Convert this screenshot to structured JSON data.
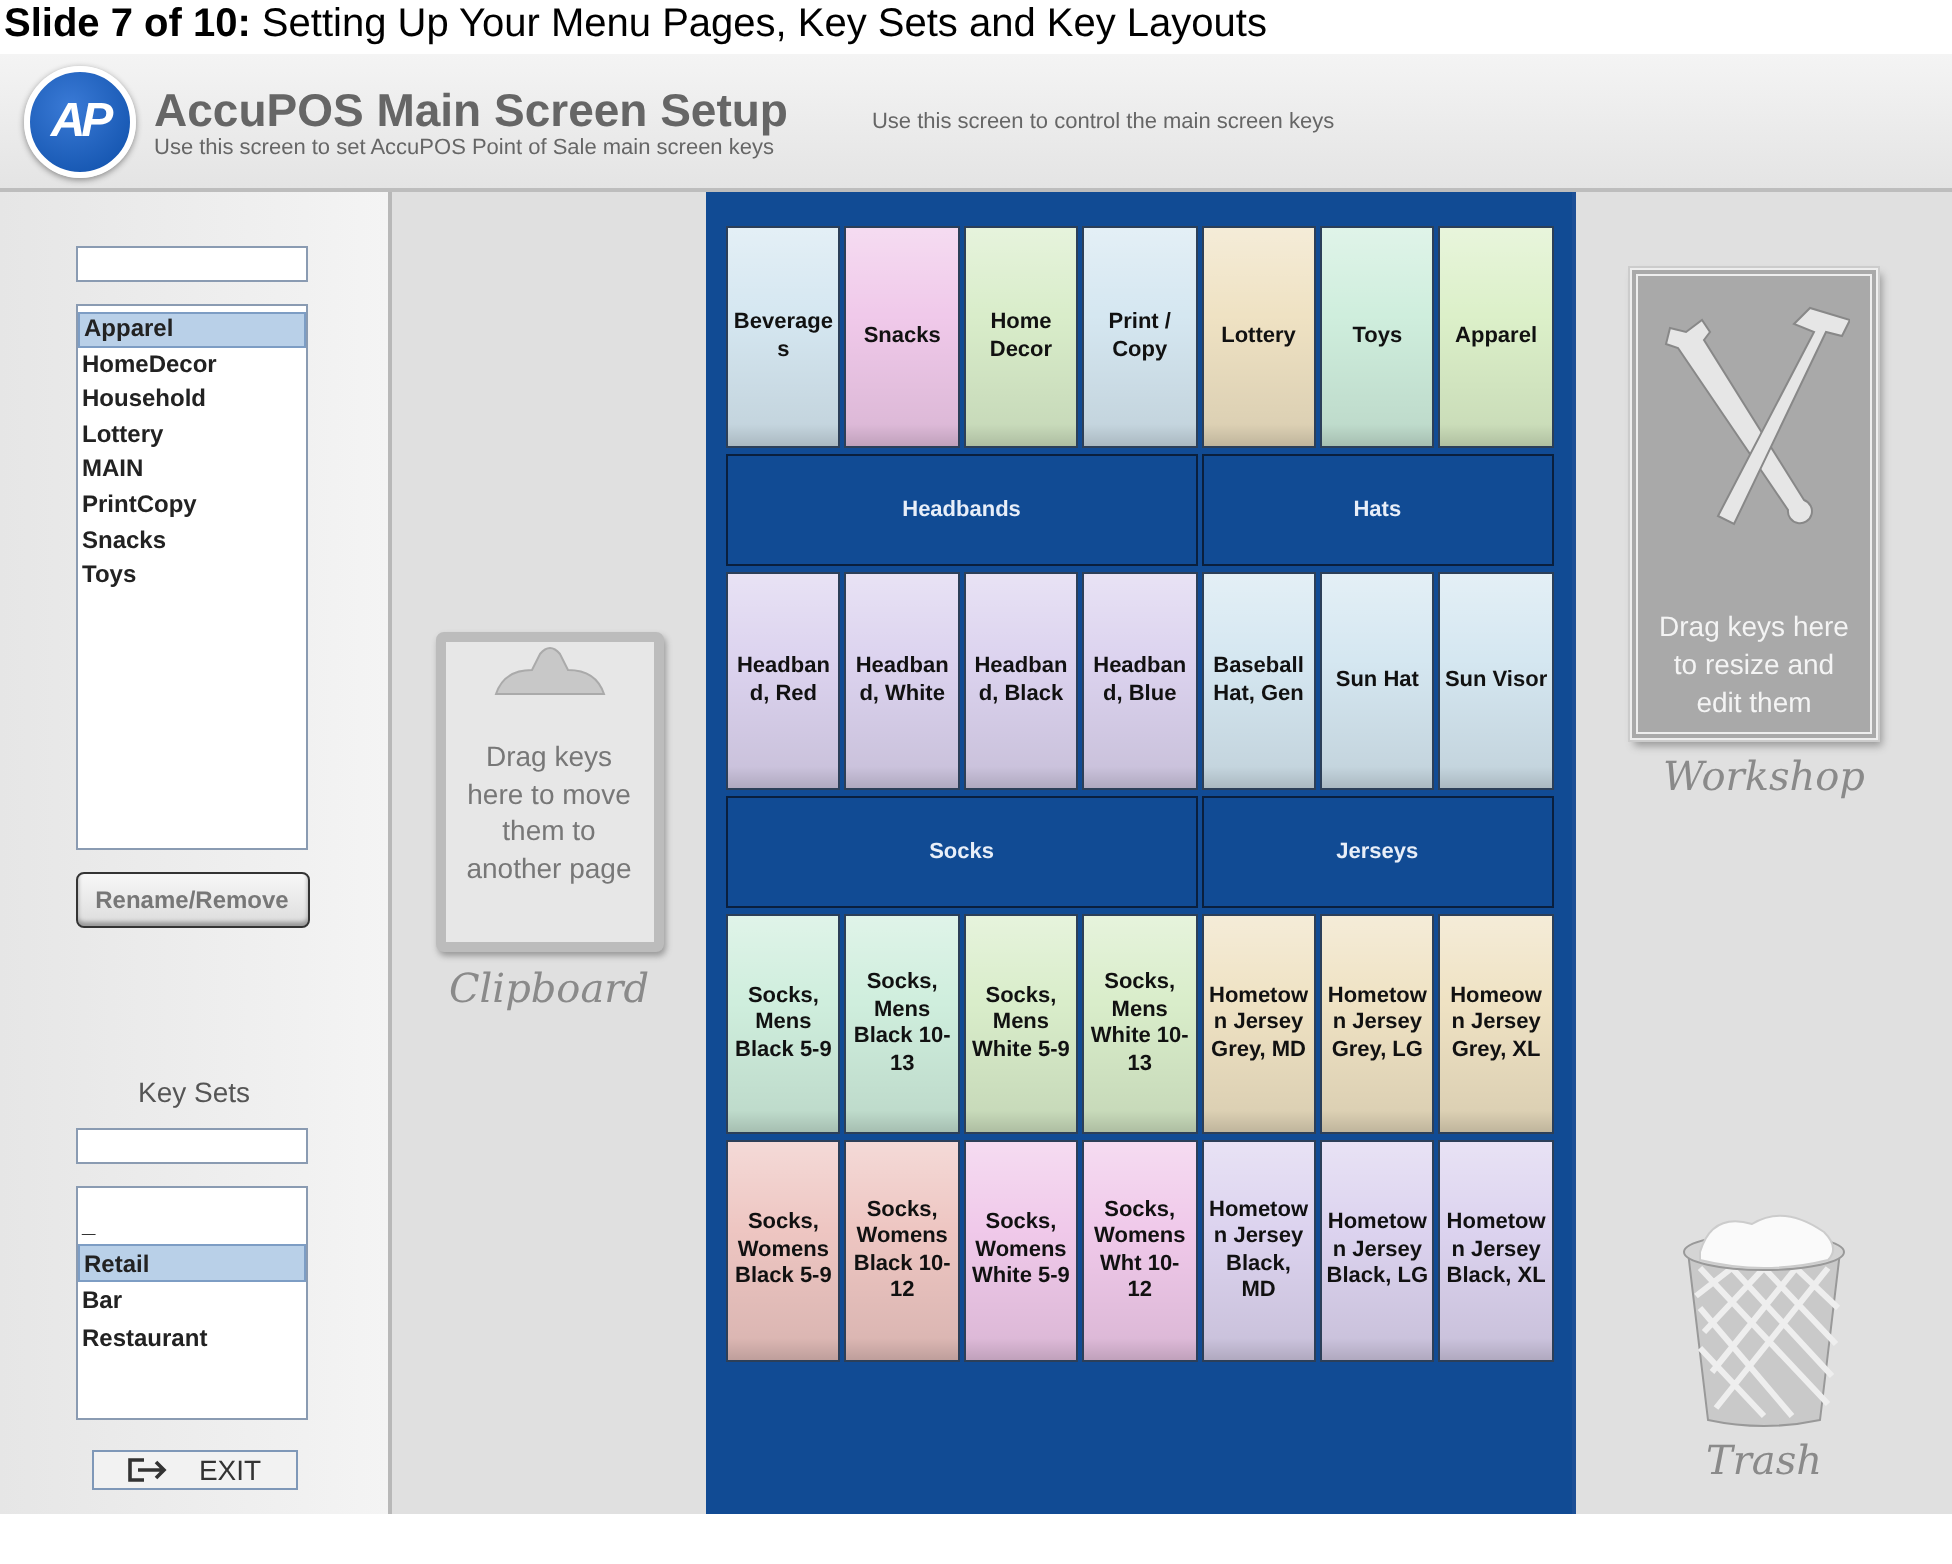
{
  "slide_title": {
    "label": "Slide 7 of 10:",
    "text": "Setting Up Your Menu Pages, Key Sets and Key Layouts"
  },
  "header": {
    "logo": "AP",
    "title": "AccuPOS Main Screen Setup",
    "subtitle": "Use this screen to set AccuPOS Point of Sale main screen keys",
    "hint": "Use this screen to control the main screen keys"
  },
  "pages": {
    "items": [
      {
        "label": "Apparel",
        "selected": true
      },
      {
        "label": "HomeDecor",
        "selected": false
      },
      {
        "label": "Household",
        "selected": false
      },
      {
        "label": "Lottery",
        "selected": false
      },
      {
        "label": "MAIN",
        "selected": false
      },
      {
        "label": "PrintCopy",
        "selected": false
      },
      {
        "label": "Snacks",
        "selected": false
      },
      {
        "label": "Toys",
        "selected": false
      }
    ],
    "button": "Rename/Remove"
  },
  "key_sets": {
    "title": "Key Sets",
    "items": [
      {
        "label": "_",
        "selected": false
      },
      {
        "label": "Retail",
        "selected": true
      },
      {
        "label": "Bar",
        "selected": false
      },
      {
        "label": "Restaurant",
        "selected": false
      }
    ],
    "exit": "EXIT"
  },
  "clipboard": {
    "text": "Drag keys here to move them to another page",
    "label": "Clipboard"
  },
  "grid": [
    {
      "kind": "keys",
      "keys": [
        {
          "label": "Beverages",
          "color": "#d5e7f1"
        },
        {
          "label": "Snacks",
          "color": "#f0c9ea"
        },
        {
          "label": "Home Decor",
          "color": "#d9edca"
        },
        {
          "label": "Print / Copy",
          "color": "#d5e7f1"
        },
        {
          "label": "Lottery",
          "color": "#efe2c3"
        },
        {
          "label": "Toys",
          "color": "#cfeedd"
        },
        {
          "label": "Apparel",
          "color": "#dcf0c9"
        }
      ]
    },
    {
      "kind": "groups",
      "groups": [
        {
          "label": "Headbands"
        },
        {
          "label": "Hats"
        }
      ]
    },
    {
      "kind": "keys",
      "keys": [
        {
          "label": "Headband, Red",
          "color": "#dcd3ef"
        },
        {
          "label": "Headband, White",
          "color": "#dcd3ef"
        },
        {
          "label": "Headband, Black",
          "color": "#dcd3ef"
        },
        {
          "label": "Headband, Blue",
          "color": "#dcd3ef"
        },
        {
          "label": "Baseball Hat, Gen",
          "color": "#d5e7f1"
        },
        {
          "label": "Sun Hat",
          "color": "#d5e7f1"
        },
        {
          "label": "Sun Visor",
          "color": "#d5e7f1"
        }
      ]
    },
    {
      "kind": "groups",
      "groups": [
        {
          "label": "Socks"
        },
        {
          "label": "Jerseys"
        }
      ]
    },
    {
      "kind": "keys",
      "keys": [
        {
          "label": "Socks, Mens Black 5-9",
          "color": "#cfeedd"
        },
        {
          "label": "Socks, Mens Black 10-13",
          "color": "#cfeedd"
        },
        {
          "label": "Socks, Mens White 5-9",
          "color": "#d9edca"
        },
        {
          "label": "Socks, Mens White 10-13",
          "color": "#d9edca"
        },
        {
          "label": "Hometown Jersey Grey, MD",
          "color": "#efe2c3"
        },
        {
          "label": "Hometown Jersey Grey, LG",
          "color": "#efe2c3"
        },
        {
          "label": "Homeown Jersey Grey, XL",
          "color": "#efe2c3"
        }
      ]
    },
    {
      "kind": "keys",
      "keys": [
        {
          "label": "Socks, Womens Black 5-9",
          "color": "#eec6c2"
        },
        {
          "label": "Socks, Womens Black 10-12",
          "color": "#eec6c2"
        },
        {
          "label": "Socks, Womens White 5-9",
          "color": "#f0c9ea"
        },
        {
          "label": "Socks, Womens Wht 10-12",
          "color": "#f0c9ea"
        },
        {
          "label": "Hometown Jersey Black, MD",
          "color": "#dcd3ef"
        },
        {
          "label": "Hometown Jersey Black, LG",
          "color": "#dcd3ef"
        },
        {
          "label": "Hometown Jersey Black, XL",
          "color": "#dcd3ef"
        }
      ]
    }
  ],
  "workshop": {
    "text": "Drag keys here to resize and edit them",
    "label": "Workshop"
  },
  "trash": {
    "label": "Trash"
  }
}
